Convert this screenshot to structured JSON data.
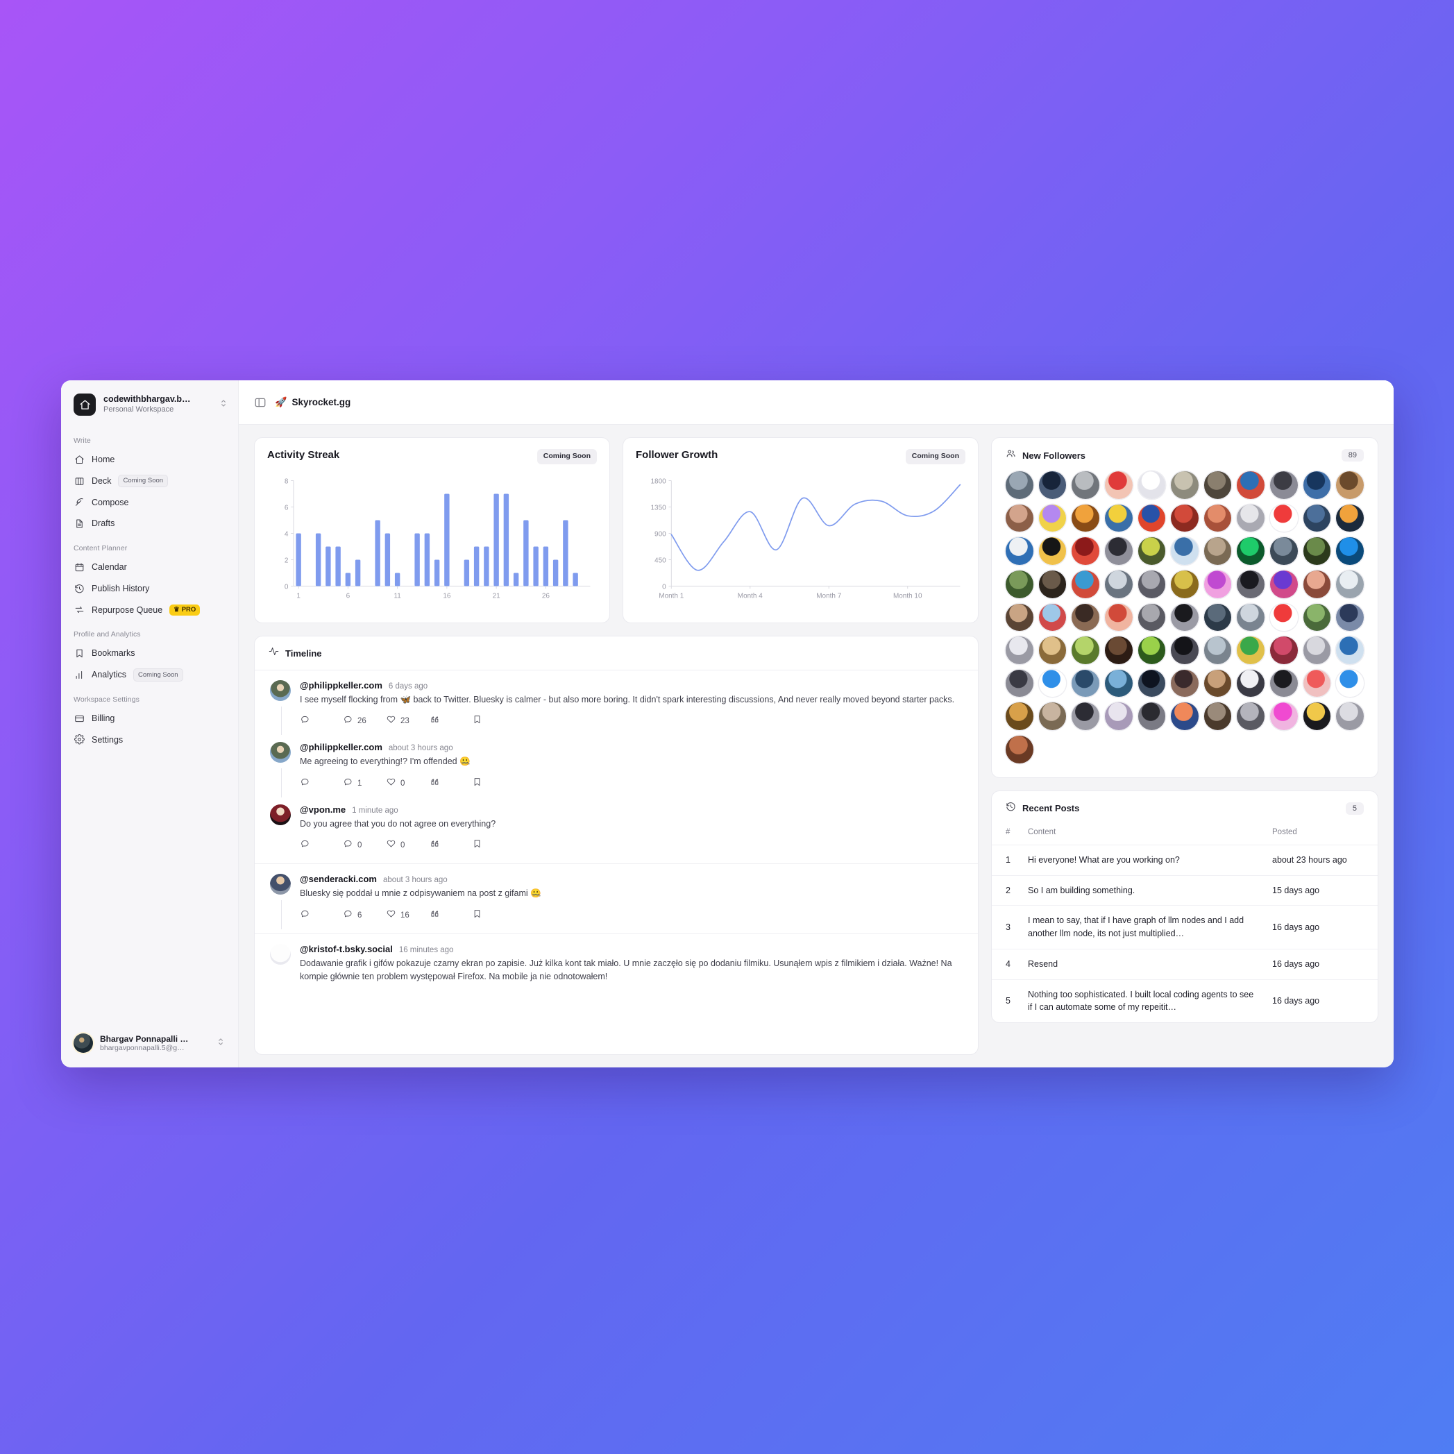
{
  "workspace": {
    "name": "codewithbhargav.b…",
    "subtitle": "Personal Workspace",
    "logo_icon": "home-icon"
  },
  "sidebar": {
    "groups": [
      {
        "label": "Write",
        "items": [
          {
            "label": "Home",
            "icon": "home-icon",
            "badge": null
          },
          {
            "label": "Deck",
            "icon": "columns-icon",
            "badge": "Coming Soon",
            "badge_type": "soon"
          },
          {
            "label": "Compose",
            "icon": "feather-icon",
            "badge": null
          },
          {
            "label": "Drafts",
            "icon": "file-icon",
            "badge": null
          }
        ]
      },
      {
        "label": "Content Planner",
        "items": [
          {
            "label": "Calendar",
            "icon": "calendar-icon",
            "badge": null
          },
          {
            "label": "Publish History",
            "icon": "history-icon",
            "badge": null
          },
          {
            "label": "Repurpose Queue",
            "icon": "repeat-icon",
            "badge": "PRO",
            "badge_type": "pro"
          }
        ]
      },
      {
        "label": "Profile and Analytics",
        "items": [
          {
            "label": "Bookmarks",
            "icon": "bookmark-icon",
            "badge": null
          },
          {
            "label": "Analytics",
            "icon": "bar-chart-icon",
            "badge": "Coming Soon",
            "badge_type": "soon"
          }
        ]
      },
      {
        "label": "Workspace Settings",
        "items": [
          {
            "label": "Billing",
            "icon": "credit-card-icon",
            "badge": null
          },
          {
            "label": "Settings",
            "icon": "gear-icon",
            "badge": null
          }
        ]
      }
    ]
  },
  "user": {
    "name": "Bhargav Ponnapalli …",
    "email": "bhargavponnapalli.5@g…"
  },
  "topbar": {
    "panel_icon": "sidebar-toggle-icon",
    "rocket_emoji": "🚀",
    "title": "Skyrocket.gg"
  },
  "chart_data": [
    {
      "type": "bar",
      "title": "Activity Streak",
      "badge": "Coming Soon",
      "xlabel": "",
      "ylabel": "",
      "ylim": [
        0,
        8
      ],
      "yticks": [
        0,
        2,
        4,
        6,
        8
      ],
      "xticks": [
        1,
        6,
        11,
        16,
        21,
        26
      ],
      "grid": false,
      "color": "#7f9bee",
      "categories": [
        1,
        2,
        3,
        4,
        5,
        6,
        7,
        8,
        9,
        10,
        11,
        12,
        13,
        14,
        15,
        16,
        17,
        18,
        19,
        20,
        21,
        22,
        23,
        24,
        25,
        26,
        27,
        28,
        29,
        30
      ],
      "values": [
        4,
        0,
        4,
        3,
        3,
        1,
        2,
        0,
        5,
        4,
        1,
        0,
        4,
        4,
        2,
        7,
        0,
        2,
        3,
        3,
        7,
        7,
        1,
        5,
        3,
        3,
        2,
        5,
        1,
        0
      ]
    },
    {
      "type": "line",
      "title": "Follower Growth",
      "badge": "Coming Soon",
      "xlabel": "",
      "ylabel": "",
      "ylim": [
        0,
        1800
      ],
      "yticks": [
        0,
        450,
        900,
        1350,
        1800
      ],
      "xtick_labels": [
        "Month 1",
        "Month 4",
        "Month 7",
        "Month 10"
      ],
      "grid": false,
      "color": "#7f9bee",
      "x": [
        1,
        2,
        3,
        4,
        5,
        6,
        7,
        8,
        9,
        10,
        11,
        12
      ],
      "values": [
        880,
        270,
        760,
        1270,
        620,
        1500,
        1030,
        1400,
        1450,
        1200,
        1280,
        1730
      ]
    }
  ],
  "timeline": {
    "header": "Timeline",
    "header_icon": "activity-icon",
    "posts": [
      {
        "handle": "@philippkeller.com",
        "time": "6 days ago",
        "text": "I see myself flocking from 🦋 back to Twitter. Bluesky is calmer - but also more boring. It didn't spark interesting discussions, And never really moved beyond starter packs.",
        "replies": "26",
        "likes": "23",
        "threaded": true,
        "avatar": "av-philipp"
      },
      {
        "handle": "@philippkeller.com",
        "time": "about 3 hours ago",
        "text": "Me agreeing to everything!? I'm offended 🤐",
        "replies": "1",
        "likes": "0",
        "threaded": true,
        "avatar": "av-philipp"
      },
      {
        "handle": "@vpon.me",
        "time": "1 minute ago",
        "text": "Do you agree that you do not agree on everything?",
        "replies": "0",
        "likes": "0",
        "threaded": false,
        "avatar": "av-vpon"
      },
      {
        "handle": "@senderacki.com",
        "time": "about 3 hours ago",
        "text": "Bluesky się poddał u mnie z odpisywaniem na post z gifami 🤐",
        "replies": "6",
        "likes": "16",
        "threaded": true,
        "avatar": "av-sender"
      },
      {
        "handle": "@kristof-t.bsky.social",
        "time": "16 minutes ago",
        "text": "Dodawanie grafik i gifów pokazuje czarny ekran po zapisie. Już kilka kont tak miało. U mnie zaczęło się po dodaniu filmiku. Usunąłem wpis z filmikiem i działa. Ważne! Na kompie głównie ten problem występował Firefox. Na mobile ja nie odnotowałem!",
        "replies": null,
        "likes": null,
        "threaded": false,
        "avatar": "av-kristof"
      }
    ],
    "action_icons": [
      "reply-icon",
      "comment-count-icon",
      "heart-icon",
      "quote-icon",
      "bookmark-icon"
    ]
  },
  "followers": {
    "title": "New Followers",
    "icon": "users-icon",
    "count": "89",
    "grid_columns": 11,
    "total": 89
  },
  "recent_posts": {
    "title": "Recent Posts",
    "icon": "history-icon",
    "count": "5",
    "columns": [
      "#",
      "Content",
      "Posted"
    ],
    "rows": [
      {
        "num": "1",
        "content": "Hi everyone! What are you working on?",
        "posted": "about 23 hours ago"
      },
      {
        "num": "2",
        "content": "So I am building something.",
        "posted": "15 days ago"
      },
      {
        "num": "3",
        "content": "I mean to say, that if I have graph of llm nodes and I add another llm node, its not just multiplied…",
        "posted": "16 days ago"
      },
      {
        "num": "4",
        "content": "Resend",
        "posted": "16 days ago"
      },
      {
        "num": "5",
        "content": "Nothing too sophisticated. I built local coding agents to see if I can automate some of my repeitit…",
        "posted": "16 days ago"
      }
    ]
  },
  "colors": {
    "accent": "#7f9bee",
    "pro_badge": "#facc15",
    "background_gradient_start": "#a855f7",
    "background_gradient_end": "#4f7df3"
  }
}
